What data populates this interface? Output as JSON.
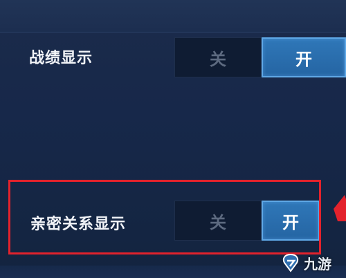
{
  "settings": {
    "rows": [
      {
        "label": "战绩显示",
        "off_label": "关",
        "on_label": "开",
        "state": "on"
      },
      {
        "label": "亲密关系显示",
        "off_label": "关",
        "on_label": "开",
        "state": "on"
      }
    ]
  },
  "watermark": {
    "text": "九游"
  },
  "colors": {
    "highlight": "#e3222c",
    "accent": "#2f77b8",
    "background": "#17284a"
  },
  "icons": {
    "arrow": "red-arrow-icon",
    "logo": "jiuyou-logo-icon"
  }
}
